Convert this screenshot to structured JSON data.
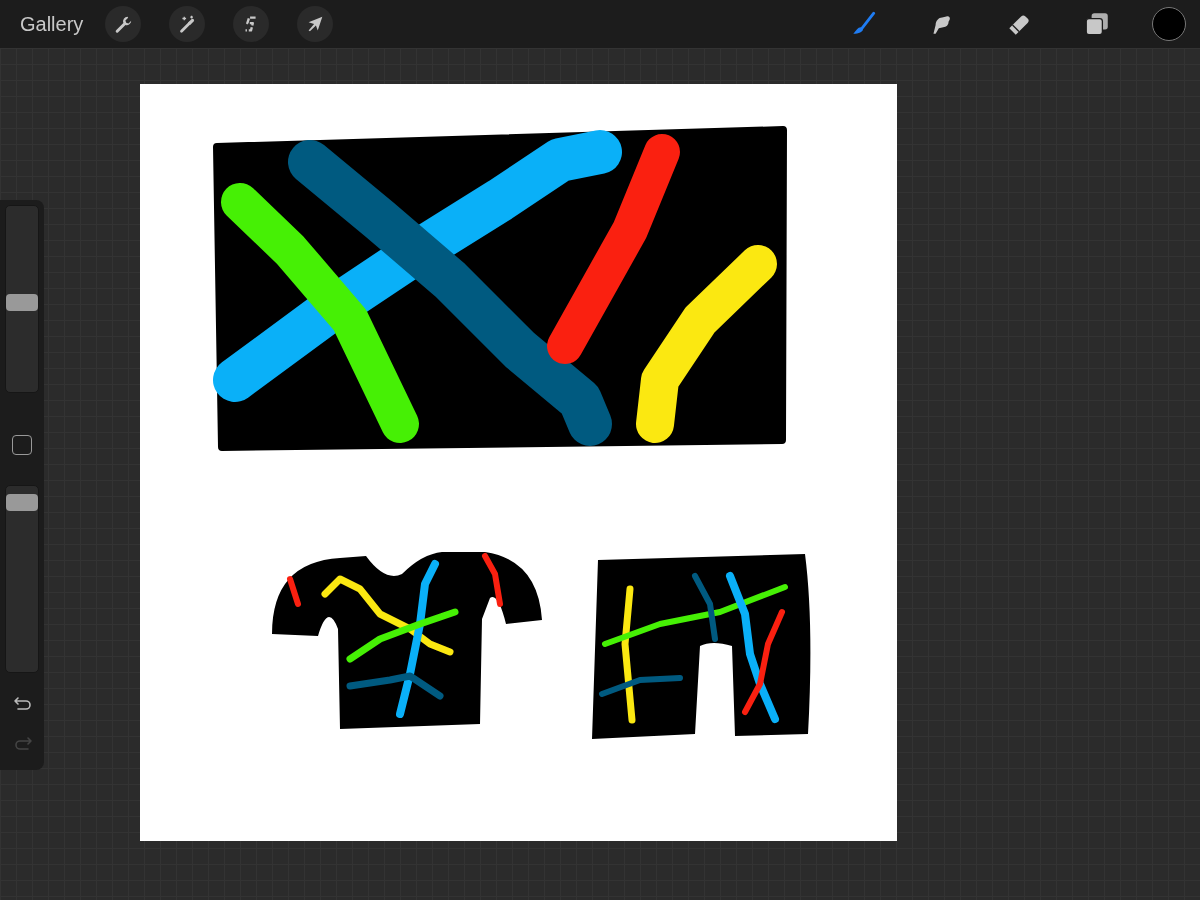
{
  "toolbar": {
    "gallery": "Gallery",
    "actions": [
      {
        "kind": "wrench"
      },
      {
        "kind": "wand"
      },
      {
        "kind": "selection"
      },
      {
        "kind": "transform"
      }
    ],
    "tools": [
      {
        "kind": "brush",
        "selected": true
      },
      {
        "kind": "smudge",
        "selected": false
      },
      {
        "kind": "eraser",
        "selected": false
      },
      {
        "kind": "layers",
        "selected": false
      }
    ],
    "color_swatch": {
      "color": "#000000"
    }
  },
  "sidebar": {
    "size_slider": {
      "level": 0.48
    },
    "opacity_slider": {
      "level": 0.95
    },
    "undo": {
      "disabled": false
    },
    "redo": {
      "disabled": true
    }
  }
}
